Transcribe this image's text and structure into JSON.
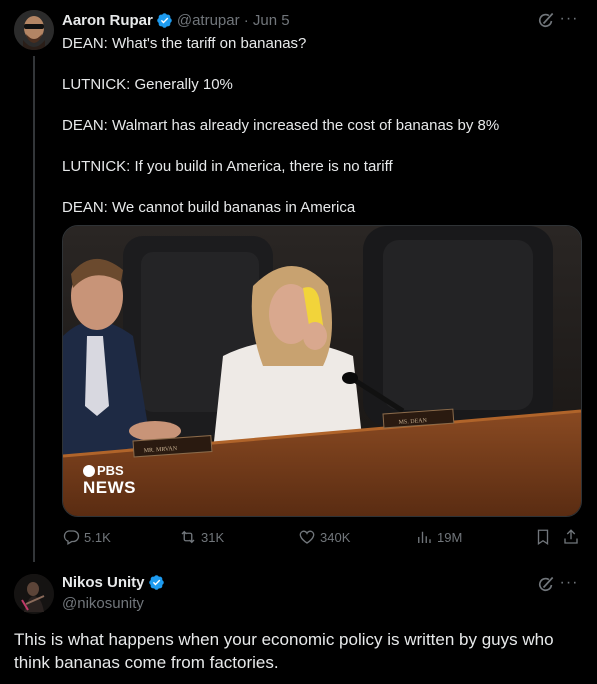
{
  "tweet": {
    "author_name": "Aaron Rupar",
    "handle_time": "@atrupar · Jun 5",
    "lines": [
      "DEAN: What's the tariff on bananas?",
      "LUTNICK: Generally 10%",
      "DEAN: Walmart has already increased the cost of bananas by 8%",
      "LUTNICK: If you build in America, there is no tariff",
      "DEAN: We cannot build bananas in America"
    ],
    "media": {
      "logo_top": "PBS",
      "logo_bottom": "NEWS",
      "nameplate_left": "MR. MRVAN",
      "nameplate_right": "MS. DEAN"
    },
    "stats": {
      "replies": "5.1K",
      "reposts": "31K",
      "likes": "340K",
      "views": "19M"
    }
  },
  "reply": {
    "author_name": "Nikos Unity",
    "handle": "@nikosunity",
    "text": "This is what happens when your economic policy is written by guys who think bananas come from factories."
  },
  "colors": {
    "background": "#000000",
    "text": "#e7e9ea",
    "muted": "#71767b",
    "verified": "#1d9bf0"
  }
}
